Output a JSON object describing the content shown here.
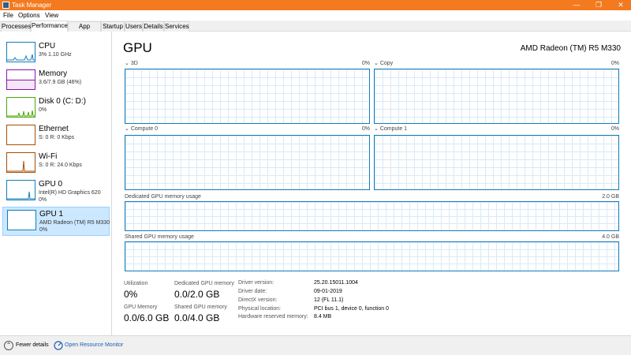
{
  "window": {
    "title": "Task Manager",
    "minimize": "—",
    "maximize": "❐",
    "close": "✕"
  },
  "menu": [
    "File",
    "Options",
    "View"
  ],
  "tabs": [
    "Processes",
    "Performance",
    "App history",
    "Startup",
    "Users",
    "Details",
    "Services"
  ],
  "active_tab": "Performance",
  "sidebar": [
    {
      "title": "CPU",
      "sub": "3% 1.10 GHz",
      "sub2": "",
      "color": "#117dbb"
    },
    {
      "title": "Memory",
      "sub": "3.6/7.9 GB (46%)",
      "sub2": "",
      "color": "#8b12ae"
    },
    {
      "title": "Disk 0 (C: D:)",
      "sub": "0%",
      "sub2": "",
      "color": "#4da60c"
    },
    {
      "title": "Ethernet",
      "sub": "S: 0 R: 0 Kbps",
      "sub2": "",
      "color": "#a74f01"
    },
    {
      "title": "Wi-Fi",
      "sub": "S: 0 R: 24.0 Kbps",
      "sub2": "",
      "color": "#a74f01"
    },
    {
      "title": "GPU 0",
      "sub": "Intel(R) HD Graphics 620",
      "sub2": "0%",
      "color": "#117dbb"
    },
    {
      "title": "GPU 1",
      "sub": "AMD Radeon (TM) R5 M330",
      "sub2": "0%",
      "color": "#117dbb"
    }
  ],
  "main": {
    "title": "GPU",
    "gpu_name": "AMD Radeon (TM) R5 M330",
    "engines": [
      {
        "label": "3D",
        "pct": "0%"
      },
      {
        "label": "Copy",
        "pct": "0%"
      },
      {
        "label": "Compute 0",
        "pct": "0%"
      },
      {
        "label": "Compute 1",
        "pct": "0%"
      }
    ],
    "dedicated": {
      "label": "Dedicated GPU memory usage",
      "max": "2.0 GB"
    },
    "shared": {
      "label": "Shared GPU memory usage",
      "max": "4.0 GB"
    },
    "stats": {
      "utilization_label": "Utilization",
      "utilization": "0%",
      "dedicated_label": "Dedicated GPU memory",
      "dedicated": "0.0/2.0 GB",
      "gpu_memory_label": "GPU Memory",
      "gpu_memory": "0.0/6.0 GB",
      "shared_label": "Shared GPU memory",
      "shared": "0.0/4.0 GB"
    },
    "info": [
      {
        "key": "Driver version:",
        "value": "25.20.15011.1004"
      },
      {
        "key": "Driver date:",
        "value": "09-01-2019"
      },
      {
        "key": "DirectX version:",
        "value": "12 (FL 11.1)"
      },
      {
        "key": "Physical location:",
        "value": "PCI bus 1, device 0, function 0"
      },
      {
        "key": "Hardware reserved memory:",
        "value": "8.4 MB"
      }
    ]
  },
  "footer": {
    "fewer_details": "Fewer details",
    "open_monitor": "Open Resource Monitor"
  }
}
